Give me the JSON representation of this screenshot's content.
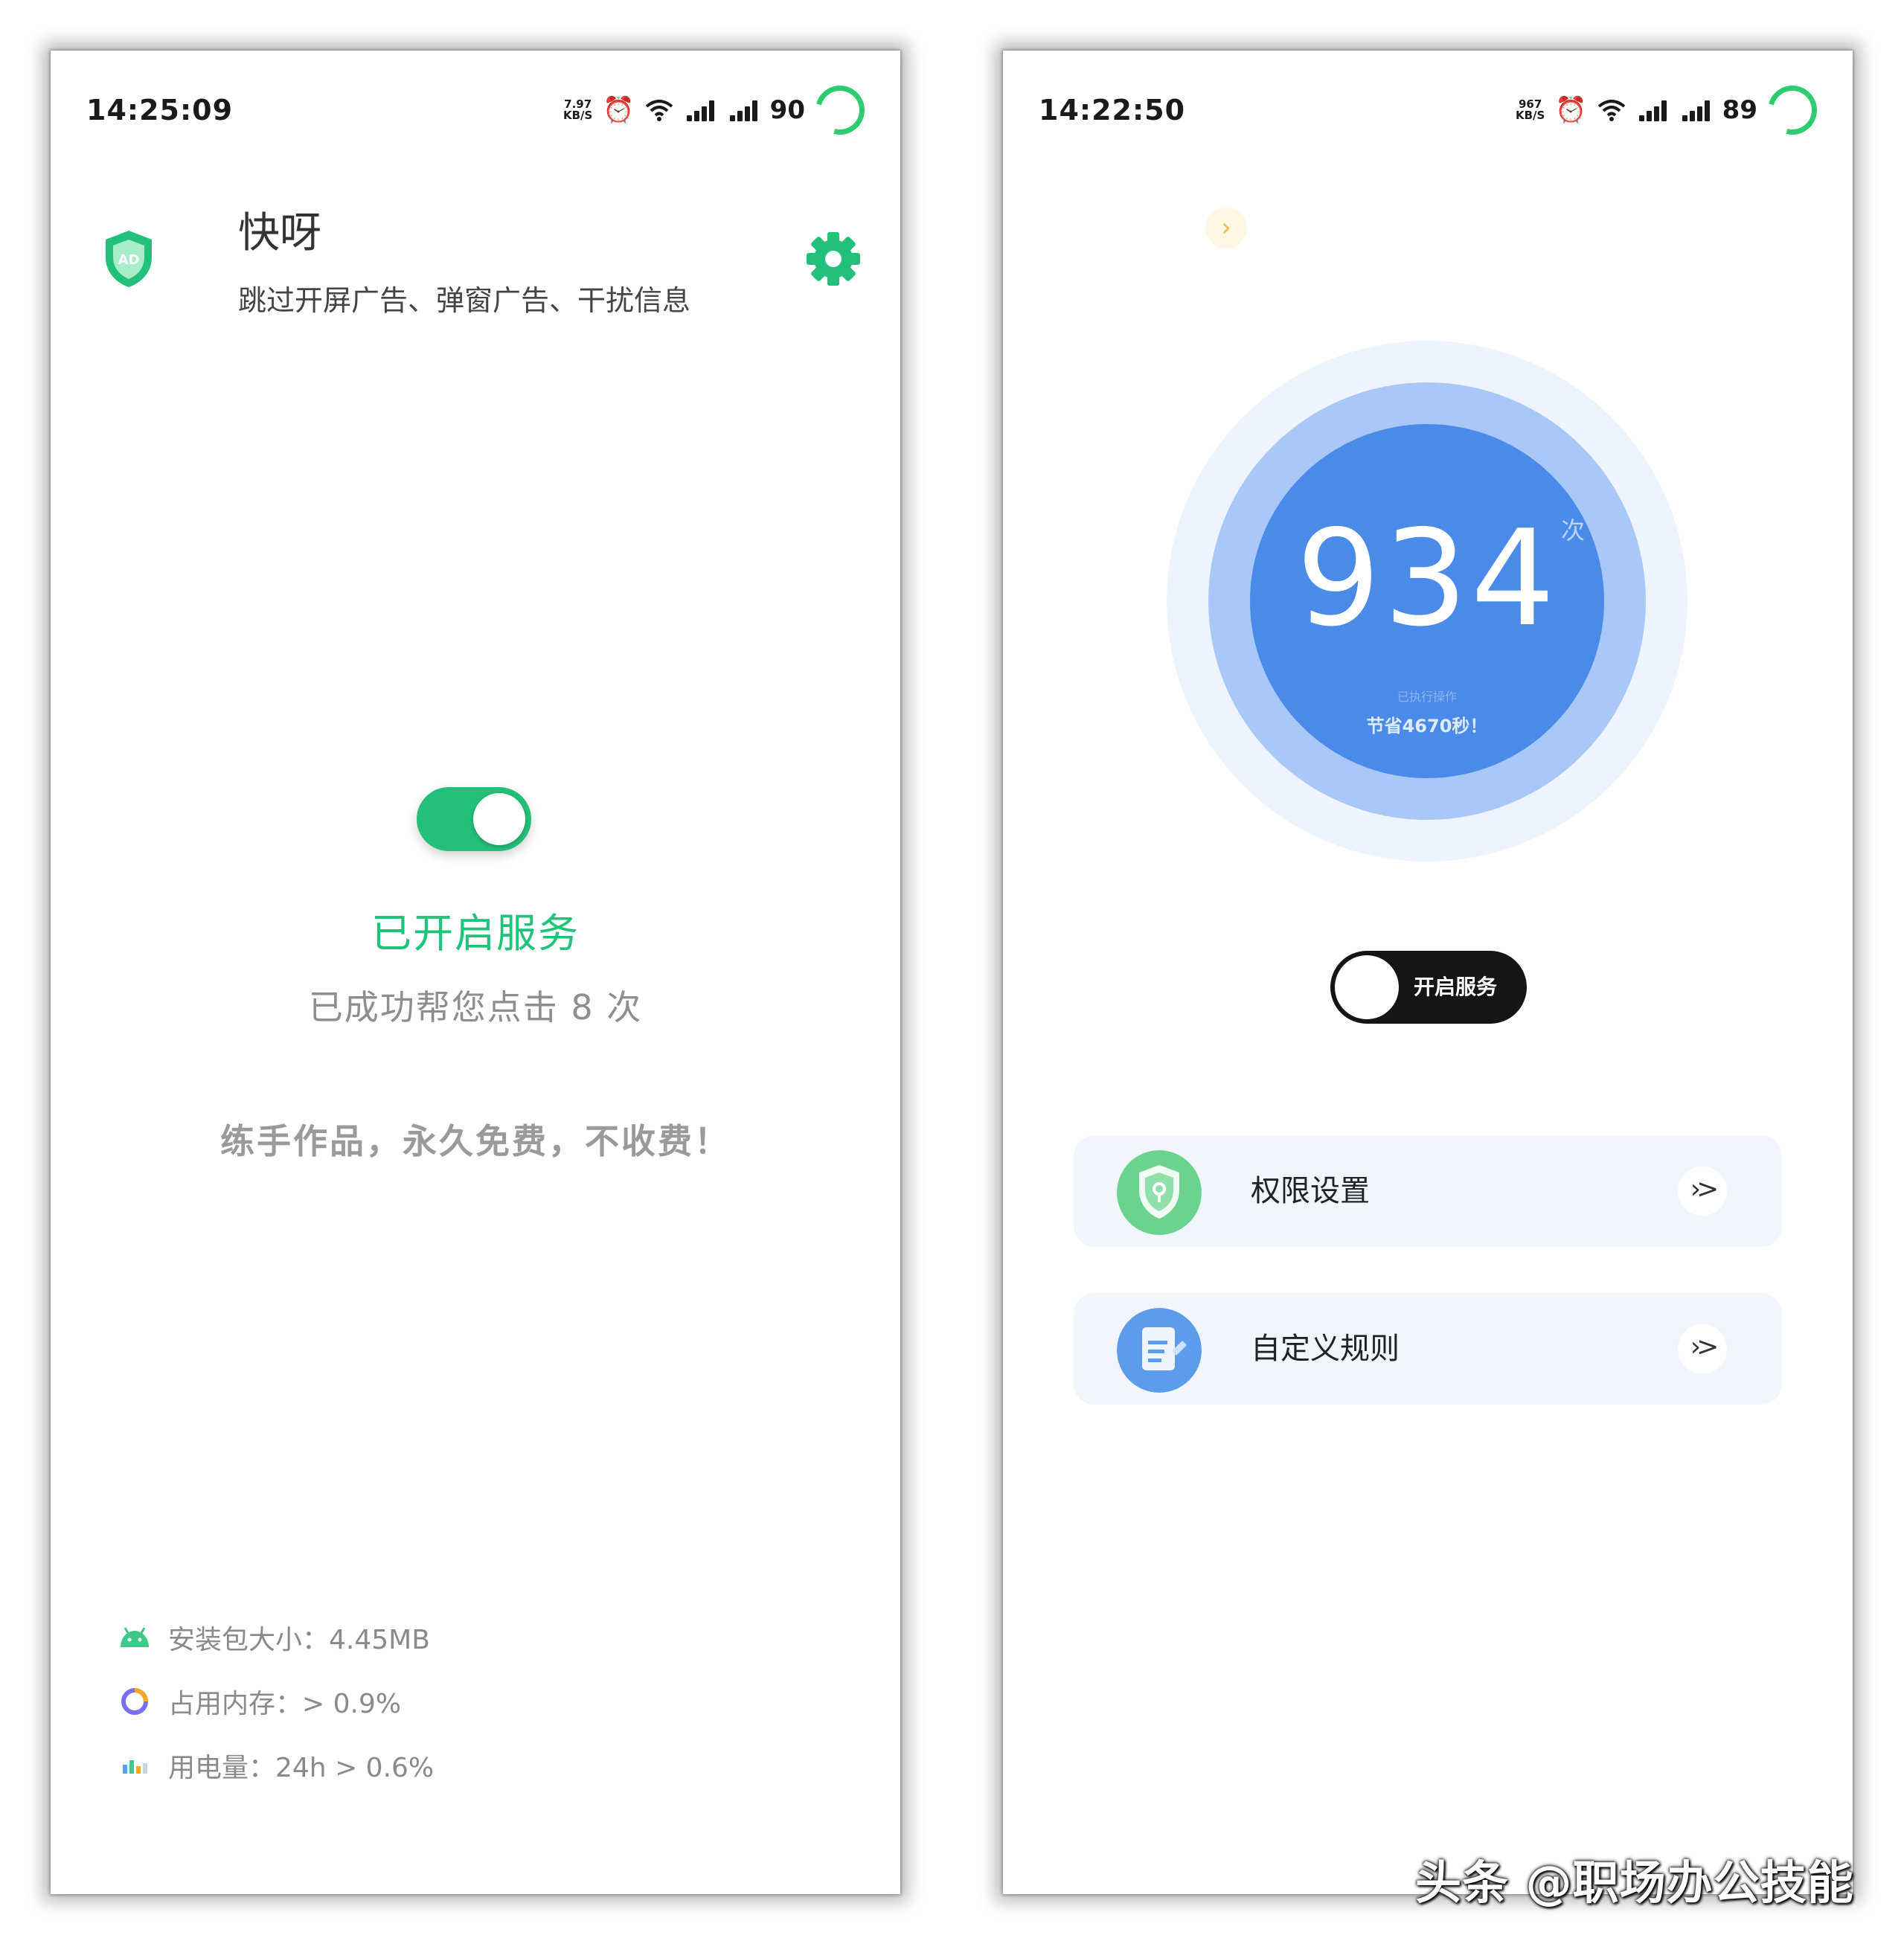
{
  "left": {
    "status": {
      "time": "14:25:09",
      "net_speed_value": "7.97",
      "net_speed_unit": "KB/S",
      "battery": "90"
    },
    "app": {
      "title": "快呀",
      "subtitle": "跳过开屏广告、弹窗广告、干扰信息",
      "logo_text": "AD"
    },
    "service": {
      "toggle_on": true,
      "status_label": "已开启服务",
      "click_count_text": "已成功帮您点击 8 次"
    },
    "note": "练手作品，永久免费，不收费！",
    "stats": [
      {
        "icon": "android-icon",
        "text": "安装包大小：4.45MB"
      },
      {
        "icon": "memory-ring-icon",
        "text": "占用内存：> 0.9%"
      },
      {
        "icon": "battery-bars-icon",
        "text": "用电量：24h > 0.6%"
      }
    ],
    "colors": {
      "accent": "#20c37a"
    }
  },
  "right": {
    "status": {
      "time": "14:22:50",
      "net_speed_value": "967",
      "net_speed_unit": "KB/S",
      "battery": "89"
    },
    "counter": {
      "value": "934",
      "unit": "次",
      "caption_small": "已执行操作",
      "saved_text": "节省4670秒！"
    },
    "service_toggle": {
      "label": "开启服务",
      "on": false
    },
    "menu": [
      {
        "label": "权限设置",
        "icon": "permission-shield-icon",
        "arrow": "›>"
      },
      {
        "label": "自定义规则",
        "icon": "custom-rule-doc-icon",
        "arrow": "›>"
      }
    ],
    "colors": {
      "accent": "#4a8ae8"
    }
  },
  "watermark": "头条 @职场办公技能"
}
